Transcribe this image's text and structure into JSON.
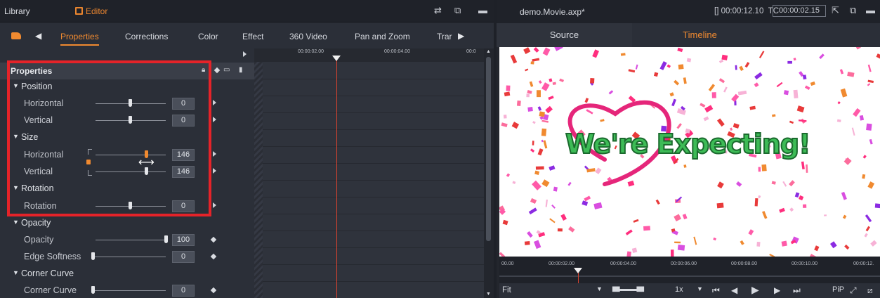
{
  "topbar": {
    "library_label": "Library",
    "editor_label": "Editor"
  },
  "tabs": {
    "items": [
      "Properties",
      "Corrections",
      "Color",
      "Effect",
      "360 Video",
      "Pan and Zoom",
      "Trar"
    ]
  },
  "properties": {
    "header": "Properties",
    "position_section": "Position",
    "position_horizontal_label": "Horizontal",
    "position_horizontal_value": "0",
    "position_vertical_label": "Vertical",
    "position_vertical_value": "0",
    "size_section": "Size",
    "size_horizontal_label": "Horizontal",
    "size_horizontal_value": "146",
    "size_vertical_label": "Vertical",
    "size_vertical_value": "146",
    "rotation_section": "Rotation",
    "rotation_label": "Rotation",
    "rotation_value": "0",
    "opacity_section": "Opacity",
    "opacity_label": "Opacity",
    "opacity_value": "100",
    "edge_softness_label": "Edge Softness",
    "edge_softness_value": "0",
    "corner_curve_section": "Corner Curve",
    "corner_curve_label": "Corner Curve",
    "corner_curve_value": "0"
  },
  "timeline": {
    "tick_1": "00:00:02.00",
    "tick_2": "00:00:04.00",
    "tick_3": "00:0"
  },
  "preview": {
    "project_title": "demo.Movie.axp*",
    "duration_label": "[] 00:00:12.10",
    "tc_label": "TC",
    "tc_value": "00:00:02.15",
    "source_tab": "Source",
    "timeline_tab": "Timeline",
    "title_text": "We're Expecting!",
    "ruler": [
      "00.00",
      "00:00:02.00",
      "00:00:04.00",
      "00:00:06.00",
      "00:00:08.00",
      "00:00:10.00",
      "00:00:12."
    ],
    "fit_label": "Fit",
    "speed_label": "1x",
    "pip_label": "PiP"
  },
  "colors": {
    "accent": "#f08a30",
    "highlight": "#e52329",
    "playhead": "#d8432f"
  }
}
